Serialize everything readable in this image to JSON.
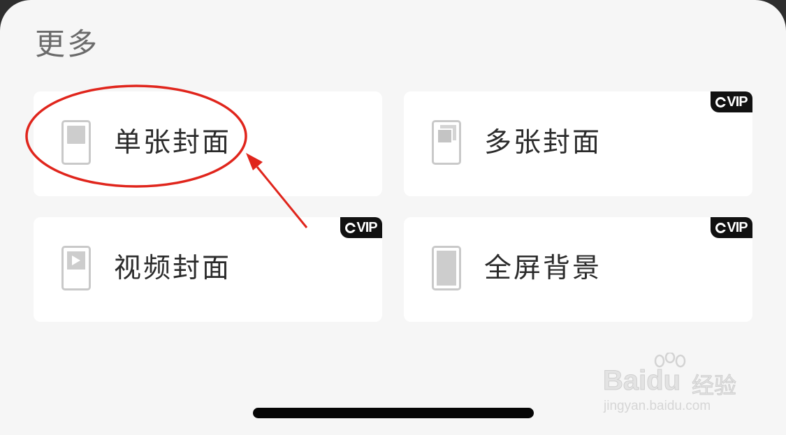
{
  "section": {
    "title": "更多"
  },
  "cards": [
    {
      "label": "单张封面",
      "icon": "single-cover-icon",
      "vip": false
    },
    {
      "label": "多张封面",
      "icon": "multi-cover-icon",
      "vip": true
    },
    {
      "label": "视频封面",
      "icon": "video-cover-icon",
      "vip": true
    },
    {
      "label": "全屏背景",
      "icon": "fullscreen-background-icon",
      "vip": true
    }
  ],
  "vip_badge": {
    "text": "VIP"
  },
  "watermark": {
    "brand": "Baidu",
    "suffix": "经验",
    "url": "jingyan.baidu.com"
  },
  "colors": {
    "annotation": "#e0251c",
    "background": "#f6f6f6",
    "card": "#ffffff"
  }
}
